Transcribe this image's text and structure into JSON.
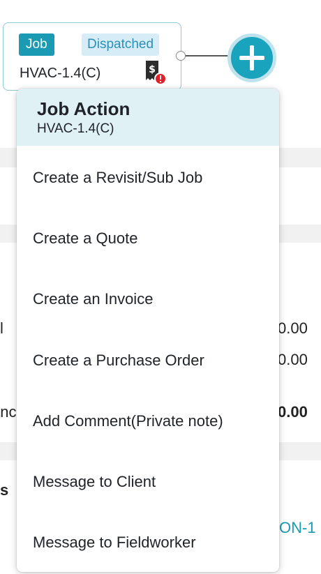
{
  "job_card": {
    "type_badge": "Job",
    "status_badge": "Dispatched",
    "job_id": "HVAC-1.4(C)"
  },
  "background": {
    "label_1": "l",
    "value_1": "0.00",
    "value_2": "0.00",
    "label_3": "anc",
    "value_3": "0.00",
    "heading_fragment": "s",
    "link_fragment": "ON-1"
  },
  "menu": {
    "title": "Job Action",
    "subtitle": "HVAC-1.4(C)",
    "items": [
      {
        "label": "Create a Revisit/Sub Job"
      },
      {
        "label": "Create a Quote"
      },
      {
        "label": "Create an Invoice"
      },
      {
        "label": "Create a Purchase Order"
      },
      {
        "label": "Add Comment(Private note)"
      },
      {
        "label": "Message to Client"
      },
      {
        "label": "Message to Fieldworker"
      }
    ]
  },
  "colors": {
    "accent": "#1aa3bd",
    "menu_header": "#dff1f4",
    "status_badge_bg": "#d6ecf6",
    "alert_red": "#e0202a"
  },
  "icons": {
    "billing": "receipt-dollar-alert-icon",
    "add": "plus-icon"
  }
}
